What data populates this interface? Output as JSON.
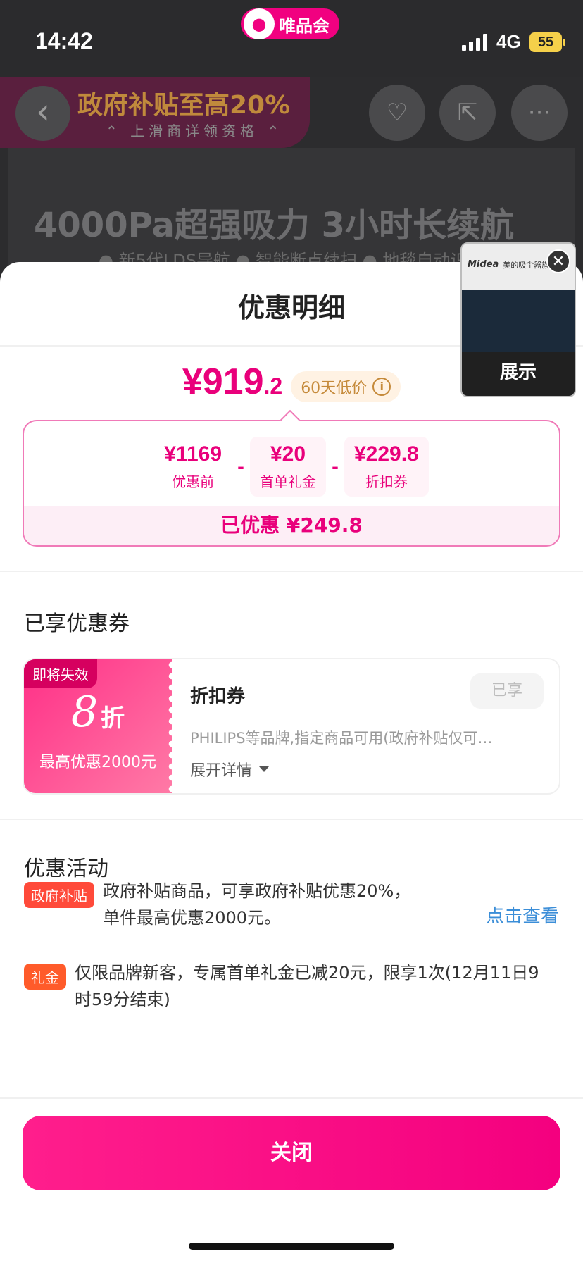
{
  "status_bar": {
    "time": "14:42",
    "app_name": "唯品会",
    "network": "4G",
    "battery": "55"
  },
  "background_page": {
    "subsidy_banner": "政府补贴至高20%",
    "subsidy_sub": "⌃ 上滑商详领资格 ⌃",
    "headline": "4000Pa超强吸力 3小时长续航",
    "features": "● 新5代LDS导航 ● 智能断点续扫 ● 地毯自动识"
  },
  "mini_video": {
    "brand": "Midea",
    "store": "美的吸尘器旗舰店",
    "label": "展示"
  },
  "sheet": {
    "title": "优惠明细",
    "price_main": "¥919",
    "price_decimal": ".2",
    "low_price_tag": "60天低价",
    "breakdown": [
      {
        "value": "¥1169",
        "label": "优惠前"
      },
      {
        "value": "¥20",
        "label": "首单礼金"
      },
      {
        "value": "¥229.8",
        "label": "折扣券"
      }
    ],
    "operator": "-",
    "saved": "已优惠 ¥249.8",
    "coupons_title": "已享优惠券",
    "coupon": {
      "expire_tag": "即将失效",
      "discount": "8",
      "discount_unit": "折",
      "max_discount": "最高优惠2000元",
      "name": "折扣券",
      "desc": "PHILIPS等品牌,指定商品可用(政府补贴仅可…",
      "expand": "展开详情",
      "status": "已享"
    },
    "activities_title": "优惠活动",
    "activities": [
      {
        "tag": "政府补贴",
        "text_line1": "政府补贴商品，可享政府补贴优惠20%，",
        "text_line2": "单件最高优惠2000元。",
        "link": "点击查看"
      },
      {
        "tag": "礼金",
        "text": "仅限品牌新客，专属首单礼金已减20元，限享1次(12月11日9时59分结束)"
      }
    ],
    "close_label": "关闭"
  },
  "colors": {
    "brand": "#f10180",
    "price": "#e9007b",
    "link": "#3b8ed8",
    "tag_red": "#ff4a3a"
  }
}
